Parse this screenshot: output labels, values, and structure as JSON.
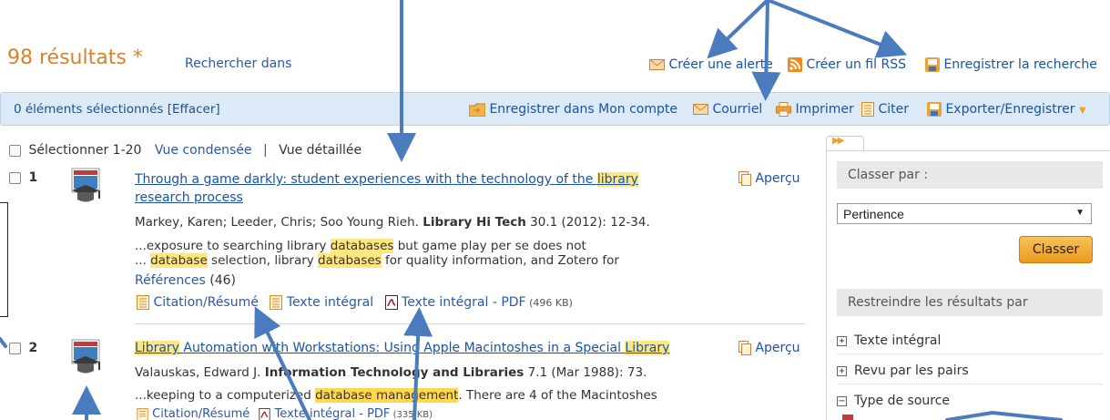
{
  "header": {
    "results_count": "98 résultats *",
    "search_within": "Rechercher dans",
    "create_alert": "Créer une alerte",
    "create_rss": "Créer un fil RSS",
    "save_search": "Enregistrer la recherche"
  },
  "toolbar": {
    "selected": "0 éléments sélectionnés [Effacer]",
    "save_account": "Enregistrer dans Mon compte",
    "email": "Courriel",
    "print": "Imprimer",
    "cite": "Citer",
    "export": "Exporter/Enregistrer"
  },
  "view": {
    "select": "Sélectionner 1-20",
    "condensed": "Vue condensée",
    "separator": "|",
    "detailed": "Vue détaillée"
  },
  "results": [
    {
      "num": "1",
      "title_pre": "Through a game darkly: student experiences with the technology of the ",
      "title_hl": "library",
      "title_post": "research process",
      "authors": "Markey, Karen; Leeder, Chris; Soo Young Rieh. ",
      "journal": "Library Hi Tech",
      "pub": " 30.1  (2012): 12-34.",
      "snip1_a": "...exposure to searching library ",
      "snip1_hl": "databases",
      "snip1_b": " but game play per se does not",
      "snip2_a": "... ",
      "snip2_hl1": "database",
      "snip2_b": " selection, library ",
      "snip2_hl2": "databases",
      "snip2_c": " for quality information, and Zotero for",
      "refs_label": "Références",
      "refs_count": " (46)",
      "citation": "Citation/Résumé",
      "fulltext": "Texte intégral",
      "pdf": "Texte intégral - PDF",
      "pdf_size": " (496 KB)",
      "preview": "Aperçu"
    },
    {
      "num": "2",
      "title_hl1": "Library",
      "title_mid": " Automation with Workstations: Using Apple Macintoshes in a Special ",
      "title_hl2": "Library",
      "authors": "Valauskas, Edward J. ",
      "journal": "Information Technology and Libraries",
      "pub": " 7.1  (Mar 1988): 73.",
      "snip_a": "...keeping to a computerized ",
      "snip_hl": "database management",
      "snip_b": ". There are 4 of the Macintoshes",
      "citation": "Citation/Résumé",
      "pdf": "Texte intégral - PDF",
      "pdf_size": " (335 KB)",
      "preview": "Aperçu"
    }
  ],
  "sidebar": {
    "sort_by": "Classer par :",
    "sort_value": "Pertinence",
    "sort_button": "Classer",
    "restrict": "Restreindre les résultats par",
    "facets": [
      "Texte intégral",
      "Revu par les pairs",
      "Type de source"
    ]
  },
  "colors": {
    "accent_orange": "#d9822b",
    "link_blue": "#1a53a6",
    "highlight": "#ffe680",
    "toolbar_bg": "#dbeaf6",
    "arrow_blue": "#4a7bbf"
  }
}
